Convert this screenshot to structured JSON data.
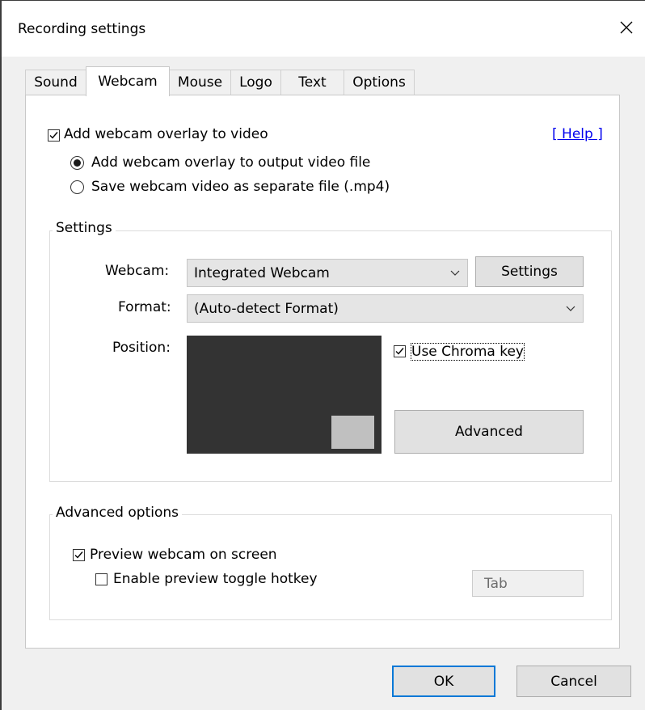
{
  "window": {
    "title": "Recording settings"
  },
  "tabs": [
    {
      "label": "Sound"
    },
    {
      "label": "Webcam"
    },
    {
      "label": "Mouse"
    },
    {
      "label": "Logo"
    },
    {
      "label": "Text"
    },
    {
      "label": "Options"
    }
  ],
  "active_tab": "Webcam",
  "webcam_tab": {
    "add_overlay_label": "Add webcam overlay to video",
    "add_overlay_checked": true,
    "help_link": "[ Help ]",
    "radio_output_label": "Add webcam overlay to output video file",
    "radio_output_selected": true,
    "radio_separate_label": "Save webcam video as separate file (.mp4)",
    "radio_separate_selected": false,
    "settings_group": {
      "title": "Settings",
      "webcam_label": "Webcam:",
      "webcam_value": "Integrated Webcam",
      "settings_button": "Settings",
      "format_label": "Format:",
      "format_value": "(Auto-detect Format)",
      "position_label": "Position:",
      "chroma_key_label": "Use Chroma key",
      "chroma_key_checked": true,
      "advanced_button": "Advanced"
    },
    "advanced_group": {
      "title": "Advanced options",
      "preview_label": "Preview webcam on screen",
      "preview_checked": true,
      "hotkey_toggle_label": "Enable preview toggle hotkey",
      "hotkey_toggle_checked": false,
      "hotkey_value": "Tab"
    }
  },
  "footer": {
    "ok_label": "OK",
    "cancel_label": "Cancel"
  },
  "colors": {
    "accent": "#0078d7",
    "link": "#0000ee",
    "preview_bg": "#333333",
    "preview_thumb": "#c0c0c0"
  },
  "icons": {
    "close": "close-icon",
    "chevron": "chevron-down-icon",
    "check": "check-icon"
  }
}
